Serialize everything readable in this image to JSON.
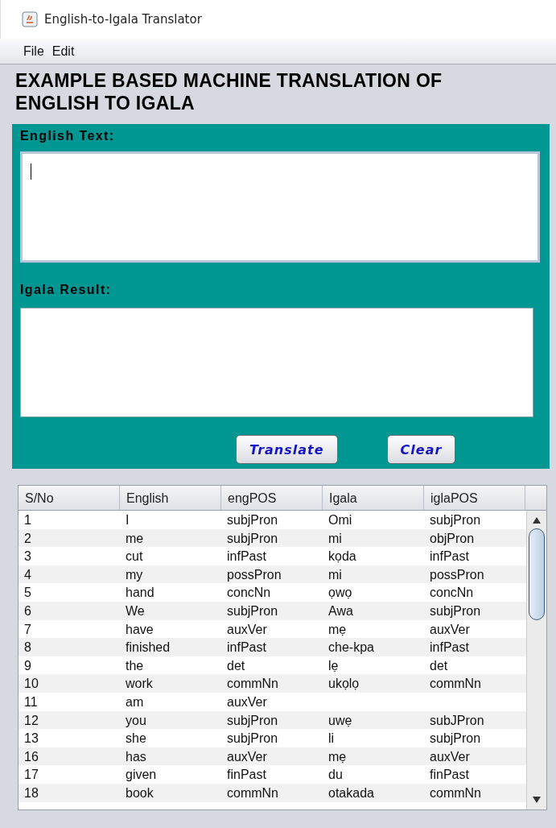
{
  "window": {
    "title": "English-to-Igala Translator"
  },
  "menu": [
    "File",
    "Edit"
  ],
  "heading": "EXAMPLE BASED MACHINE TRANSLATION OF ENGLISH TO IGALA",
  "english_field": {
    "label": "English Text:"
  },
  "result_field": {
    "label": "Igala Result:"
  },
  "buttons": [
    "Translate",
    "Clear"
  ],
  "table": {
    "columns": [
      "S/No",
      "English",
      "engPOS",
      "Igala",
      "iglaPOS"
    ],
    "rows": [
      [
        "1",
        "I",
        "subjPron",
        "Omi",
        "subjPron"
      ],
      [
        "2",
        "me",
        "subjPron",
        "mi",
        "objPron"
      ],
      [
        "3",
        "cut",
        "infPast",
        "kọda",
        "infPast"
      ],
      [
        "4",
        "my",
        "possPron",
        "mi",
        "possPron"
      ],
      [
        "5",
        "hand",
        "concNn",
        "ọwọ",
        "concNn"
      ],
      [
        "6",
        "We",
        "subjPron",
        "Awa",
        "subjPron"
      ],
      [
        "7",
        "have",
        "auxVer",
        "mẹ",
        "auxVer"
      ],
      [
        "8",
        "finished",
        "infPast",
        "che-kpa",
        "infPast"
      ],
      [
        "9",
        "the",
        "det",
        "lẹ",
        "det"
      ],
      [
        "10",
        "work",
        "commNn",
        "ukọlọ",
        "commNn"
      ],
      [
        "11",
        "am",
        "auxVer",
        "",
        ""
      ],
      [
        "12",
        "you",
        "subjPron",
        "uwẹ",
        "subJPron"
      ],
      [
        "13",
        "she",
        "subjPron",
        "li",
        "subjPron"
      ],
      [
        "16",
        "has",
        "auxVer",
        "mẹ",
        "auxVer"
      ],
      [
        "17",
        "given",
        "finPast",
        "du",
        "finPast"
      ],
      [
        "18",
        "book",
        "commNn",
        "otakada",
        "commNn"
      ]
    ]
  }
}
